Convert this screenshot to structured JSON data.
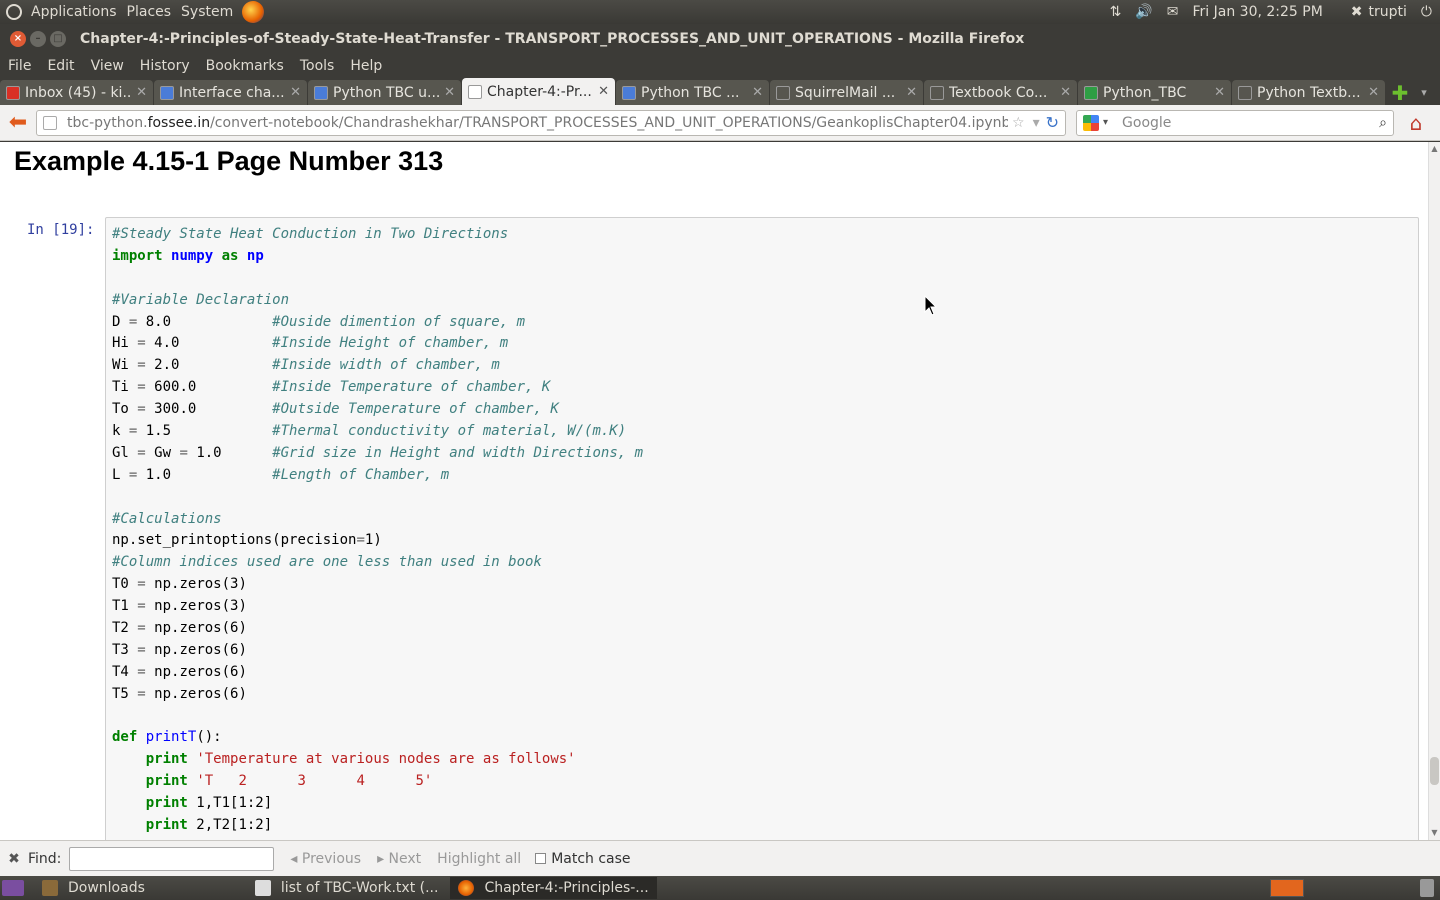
{
  "top_panel": {
    "menus": [
      "Applications",
      "Places",
      "System"
    ],
    "datetime": "Fri Jan 30,  2:25 PM",
    "user": "trupti"
  },
  "window": {
    "title": "Chapter-4:-Principles-of-Steady-State-Heat-Transfer - TRANSPORT_PROCESSES_AND_UNIT_OPERATIONS - Mozilla Firefox"
  },
  "menubar": [
    "File",
    "Edit",
    "View",
    "History",
    "Bookmarks",
    "Tools",
    "Help"
  ],
  "tabs": [
    {
      "label": "Inbox (45) - ki...",
      "icon_color": "#d93025"
    },
    {
      "label": "Interface cha...",
      "icon_color": "#4a7cd8"
    },
    {
      "label": "Python TBC u...",
      "icon_color": "#4a7cd8"
    },
    {
      "label": "Chapter-4:-Pr...",
      "icon_color": "#ffffff",
      "active": true
    },
    {
      "label": "Python TBC ...",
      "icon_color": "#4a7cd8"
    },
    {
      "label": "SquirrelMail ...",
      "icon_color": "#57564f"
    },
    {
      "label": "Textbook Co...",
      "icon_color": "#57564f"
    },
    {
      "label": "Python_TBC",
      "icon_color": "#2e9e44"
    },
    {
      "label": "Python Textb...",
      "icon_color": "#57564f"
    }
  ],
  "navbar": {
    "url_prefix": "tbc-python.",
    "url_domain": "fossee.in",
    "url_rest": "/convert-notebook/Chandrashekhar/TRANSPORT_PROCESSES_AND_UNIT_OPERATIONS/GeankoplisChapter04.ipynb",
    "search_placeholder": "Google"
  },
  "page": {
    "heading": "Example 4.15-1 Page Number 313",
    "prompt": "In [19]:"
  },
  "findbar": {
    "label": "Find:",
    "previous": "Previous",
    "next": "Next",
    "highlight_all": "Highlight all",
    "match_case": "Match case"
  },
  "taskbar": [
    {
      "label": "Downloads",
      "active": false
    },
    {
      "label": "list of TBC-Work.txt (...",
      "active": false
    },
    {
      "label": "Chapter-4:-Principles-...",
      "active": true
    }
  ],
  "code_lines": [
    [
      {
        "t": "#Steady State Heat Conduction in Two Directions",
        "c": "c"
      }
    ],
    [
      {
        "t": "import",
        "c": "k"
      },
      {
        "t": " "
      },
      {
        "t": "numpy",
        "c": "n"
      },
      {
        "t": " "
      },
      {
        "t": "as",
        "c": "k"
      },
      {
        "t": " "
      },
      {
        "t": "np",
        "c": "n"
      }
    ],
    [],
    [
      {
        "t": "#Variable Declaration",
        "c": "c"
      }
    ],
    [
      {
        "t": "D "
      },
      {
        "t": "=",
        "c": "m"
      },
      {
        "t": " 8.0            "
      },
      {
        "t": "#Ouside dimention of square, m",
        "c": "c"
      }
    ],
    [
      {
        "t": "Hi "
      },
      {
        "t": "=",
        "c": "m"
      },
      {
        "t": " 4.0           "
      },
      {
        "t": "#Inside Height of chamber, m",
        "c": "c"
      }
    ],
    [
      {
        "t": "Wi "
      },
      {
        "t": "=",
        "c": "m"
      },
      {
        "t": " 2.0           "
      },
      {
        "t": "#Inside width of chamber, m",
        "c": "c"
      }
    ],
    [
      {
        "t": "Ti "
      },
      {
        "t": "=",
        "c": "m"
      },
      {
        "t": " 600.0         "
      },
      {
        "t": "#Inside Temperature of chamber, K",
        "c": "c"
      }
    ],
    [
      {
        "t": "To "
      },
      {
        "t": "=",
        "c": "m"
      },
      {
        "t": " 300.0         "
      },
      {
        "t": "#Outside Temperature of chamber, K",
        "c": "c"
      }
    ],
    [
      {
        "t": "k "
      },
      {
        "t": "=",
        "c": "m"
      },
      {
        "t": " 1.5            "
      },
      {
        "t": "#Thermal conductivity of material, W/(m.K)",
        "c": "c"
      }
    ],
    [
      {
        "t": "Gl "
      },
      {
        "t": "=",
        "c": "m"
      },
      {
        "t": " Gw "
      },
      {
        "t": "=",
        "c": "m"
      },
      {
        "t": " 1.0      "
      },
      {
        "t": "#Grid size in Height and width Directions, m",
        "c": "c"
      }
    ],
    [
      {
        "t": "L "
      },
      {
        "t": "=",
        "c": "m"
      },
      {
        "t": " 1.0            "
      },
      {
        "t": "#Length of Chamber, m",
        "c": "c"
      }
    ],
    [],
    [
      {
        "t": "#Calculations",
        "c": "c"
      }
    ],
    [
      {
        "t": "np"
      },
      {
        "t": "."
      },
      {
        "t": "set_printoptions"
      },
      {
        "t": "(precision"
      },
      {
        "t": "=",
        "c": "m"
      },
      {
        "t": "1)"
      }
    ],
    [
      {
        "t": "#Column indices used are one less than used in book",
        "c": "c"
      }
    ],
    [
      {
        "t": "T0 "
      },
      {
        "t": "=",
        "c": "m"
      },
      {
        "t": " np"
      },
      {
        "t": "."
      },
      {
        "t": "zeros(3)"
      }
    ],
    [
      {
        "t": "T1 "
      },
      {
        "t": "=",
        "c": "m"
      },
      {
        "t": " np"
      },
      {
        "t": "."
      },
      {
        "t": "zeros(3)"
      }
    ],
    [
      {
        "t": "T2 "
      },
      {
        "t": "=",
        "c": "m"
      },
      {
        "t": " np"
      },
      {
        "t": "."
      },
      {
        "t": "zeros(6)"
      }
    ],
    [
      {
        "t": "T3 "
      },
      {
        "t": "=",
        "c": "m"
      },
      {
        "t": " np"
      },
      {
        "t": "."
      },
      {
        "t": "zeros(6)"
      }
    ],
    [
      {
        "t": "T4 "
      },
      {
        "t": "=",
        "c": "m"
      },
      {
        "t": " np"
      },
      {
        "t": "."
      },
      {
        "t": "zeros(6)"
      }
    ],
    [
      {
        "t": "T5 "
      },
      {
        "t": "=",
        "c": "m"
      },
      {
        "t": " np"
      },
      {
        "t": "."
      },
      {
        "t": "zeros(6)"
      }
    ],
    [],
    [
      {
        "t": "def",
        "c": "k"
      },
      {
        "t": " "
      },
      {
        "t": "printT",
        "c": "f"
      },
      {
        "t": "():"
      }
    ],
    [
      {
        "t": "    "
      },
      {
        "t": "print",
        "c": "k"
      },
      {
        "t": " "
      },
      {
        "t": "'Temperature at various nodes are as follows'",
        "c": "s"
      }
    ],
    [
      {
        "t": "    "
      },
      {
        "t": "print",
        "c": "k"
      },
      {
        "t": " "
      },
      {
        "t": "'T   2      3      4      5'",
        "c": "s"
      }
    ],
    [
      {
        "t": "    "
      },
      {
        "t": "print",
        "c": "k"
      },
      {
        "t": " 1,T1[1:2]"
      }
    ],
    [
      {
        "t": "    "
      },
      {
        "t": "print",
        "c": "k"
      },
      {
        "t": " 2,T2[1:2]"
      }
    ]
  ]
}
